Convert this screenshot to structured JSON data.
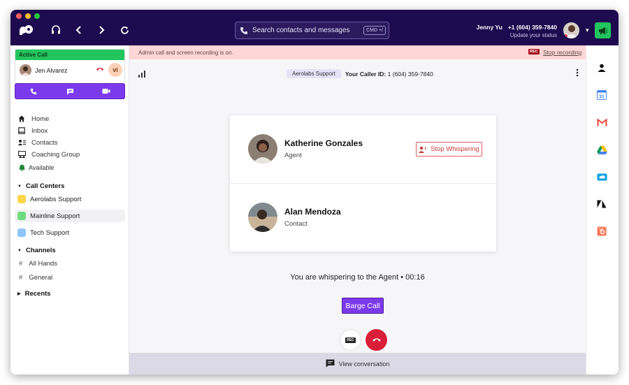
{
  "titlebar": {
    "search_placeholder": "Search contacts and messages",
    "search_shortcut": "CMD +/",
    "user_name": "Jenny Yu",
    "user_phone": "+1 (604) 359-7840",
    "user_status": "Update your status"
  },
  "sidebar": {
    "active_call_header": "Active Call",
    "active_call_name": "Jen Alvarez",
    "active_call_initials": "vi",
    "nav": [
      "Home",
      "Inbox",
      "Contacts",
      "Coaching Group"
    ],
    "availability": "Available",
    "call_centers_title": "Call Centers",
    "call_centers": [
      {
        "label": "Aerolabs Support",
        "color": "#ffd54a"
      },
      {
        "label": "Mainline Support",
        "color": "#6ddc7f"
      },
      {
        "label": "Tech Support",
        "color": "#8ec5ff"
      }
    ],
    "channels_title": "Channels",
    "channels": [
      "All Hands",
      "General"
    ],
    "recents_title": "Recents"
  },
  "main": {
    "banner_text": "Admin call and screen recording is on.",
    "rec_badge": "REC",
    "stop_recording": "Stop recording",
    "call_center_pill": "Aerolabs Support",
    "caller_id_label": "Your Caller ID:",
    "caller_id_value": "1 (604) 359-7840",
    "agent_name": "Katherine Gonzales",
    "agent_role": "Agent",
    "stop_whispering": "Stop Whispering",
    "contact_name": "Alan Mendoza",
    "contact_role": "Contact",
    "status_line": "You are whispering to the Agent • 00:16",
    "barge_label": "Barge Call",
    "rec_button_label": "REC",
    "view_conversation": "View conversation"
  },
  "colors": {
    "titlebar": "#1e0a4e",
    "accent_purple": "#7c3aed",
    "active_green": "#22c55e",
    "hangup_red": "#d91e3a",
    "banner_pink": "#ffd6d6"
  },
  "right_rail_icons": [
    "person-icon",
    "google-calendar-icon",
    "gmail-icon",
    "google-drive-icon",
    "salesforce-icon",
    "zendesk-icon",
    "hubspot-icon"
  ]
}
